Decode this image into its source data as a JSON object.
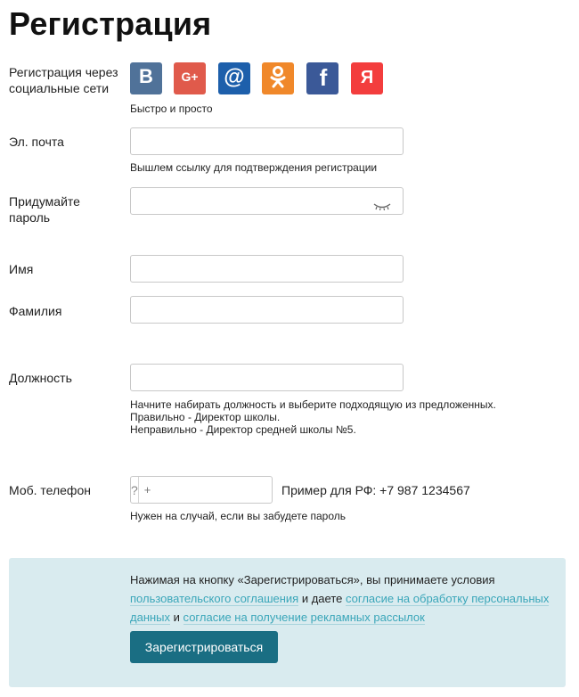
{
  "page": {
    "title": "Регистрация"
  },
  "social": {
    "label": "Регистрация через социальные сети",
    "hint": "Быстро и просто",
    "buttons": [
      {
        "name": "vkontakte",
        "glyph": "B",
        "color": "#507299"
      },
      {
        "name": "google-plus",
        "glyph": "G+",
        "color": "#e05a4b"
      },
      {
        "name": "mail-ru",
        "glyph": "@",
        "color": "#1d5fab"
      },
      {
        "name": "odnoklassniki",
        "glyph": "ok",
        "color": "#f0882a"
      },
      {
        "name": "facebook",
        "glyph": "f",
        "color": "#3b5998"
      },
      {
        "name": "yandex",
        "glyph": "Я",
        "color": "#f33d3d"
      }
    ]
  },
  "email": {
    "label": "Эл. почта",
    "value": "",
    "hint": "Вышлем ссылку для подтверждения регистрации"
  },
  "password": {
    "label": "Придумайте пароль",
    "value": ""
  },
  "first_name": {
    "label": "Имя",
    "value": ""
  },
  "last_name": {
    "label": "Фамилия",
    "value": ""
  },
  "position": {
    "label": "Должность",
    "value": "",
    "hint1": "Начните набирать должность и выберите подходящую из предложенных.",
    "hint2": "Правильно - Директор школы.",
    "hint3": "Неправильно - Директор средней школы №5."
  },
  "phone": {
    "label": "Моб. телефон",
    "code": "?",
    "placeholder": "+",
    "example": "Пример для РФ: +7 987 1234567",
    "hint": "Нужен на случай, если вы забудете пароль"
  },
  "consent": {
    "text_start": "Нажимая на кнопку «Зарегистрироваться», вы принимаете условия",
    "link_agreement": "пользовательского соглашения",
    "text_and_give": "и даете",
    "link_personal_data": "согласие на обработку персональных данных",
    "text_and": "и",
    "link_ads": "согласие на получение рекламных рассылок",
    "submit_label": "Зарегистрироваться"
  }
}
